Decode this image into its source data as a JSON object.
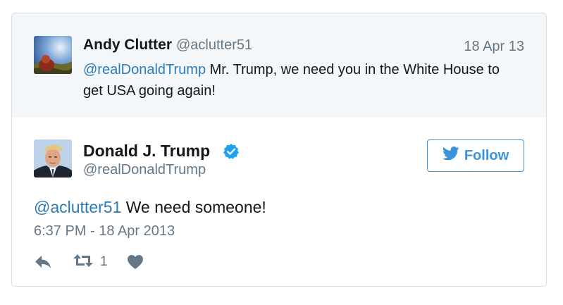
{
  "quoted_tweet": {
    "author_name": "Andy Clutter",
    "author_handle": "@aclutter51",
    "date": "18 Apr 13",
    "mention": "@realDonaldTrump",
    "text": " Mr. Trump, we need you in the White House to get USA going again!"
  },
  "tweet": {
    "author_name": "Donald J. Trump",
    "author_handle": "@realDonaldTrump",
    "verified": true,
    "mention": "@aclutter51",
    "text": " We need someone!",
    "timestamp": "6:37 PM - 18 Apr 2013",
    "retweet_count": "1"
  },
  "follow_button": {
    "label": "Follow"
  },
  "icons": {
    "reply": "reply-icon",
    "retweet": "retweet-icon",
    "like": "heart-icon",
    "verified": "verified-badge-icon",
    "follow": "twitter-bird-icon"
  },
  "colors": {
    "link": "#2b7bb9",
    "follow_accent": "#3b94d9",
    "muted": "#657786",
    "quoted_bg": "#f4f7f9",
    "verified": "#1da1f2"
  }
}
